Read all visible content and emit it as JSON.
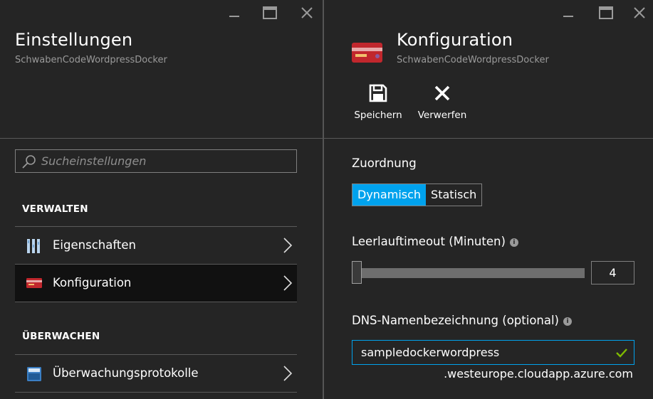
{
  "left_blade": {
    "title": "Einstellungen",
    "subtitle": "SchwabenCodeWordpressDocker",
    "search": {
      "placeholder": "Sucheinstellungen",
      "value": ""
    },
    "sections": [
      {
        "header": "VERWALTEN",
        "items": [
          {
            "label": "Eigenschaften",
            "icon": "properties-icon",
            "active": false
          },
          {
            "label": "Konfiguration",
            "icon": "configuration-card-icon",
            "active": true
          }
        ]
      },
      {
        "header": "ÜBERWACHEN",
        "items": [
          {
            "label": "Überwachungsprotokolle",
            "icon": "audit-log-icon",
            "active": false
          }
        ]
      }
    ]
  },
  "right_blade": {
    "title": "Konfiguration",
    "subtitle": "SchwabenCodeWordpressDocker",
    "toolbar": {
      "save_label": "Speichern",
      "discard_label": "Verwerfen"
    },
    "assignment": {
      "label": "Zuordnung",
      "options": [
        "Dynamisch",
        "Statisch"
      ],
      "selected": "Dynamisch"
    },
    "idle_timeout": {
      "label": "Leerlauftimeout (Minuten)",
      "value": "4",
      "slider_fraction": 0.0
    },
    "dns": {
      "label": "DNS-Namenbezeichnung (optional)",
      "value": "sampledockerwordpress",
      "suffix": ".westeurope.cloudapp.azure.com"
    }
  },
  "colors": {
    "background": "#252525",
    "accent": "#00a2ed",
    "valid_check": "#7fba00",
    "card_red": "#c1272d"
  }
}
